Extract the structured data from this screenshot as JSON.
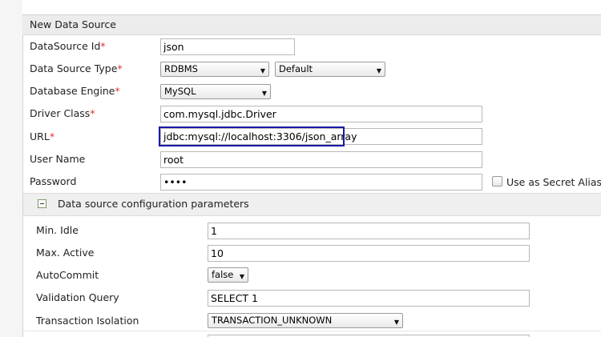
{
  "panel": {
    "title": "New Data Source"
  },
  "required_marker": "*",
  "fields": {
    "datasource_id": {
      "label": "DataSource Id",
      "value": "json"
    },
    "data_source_type": {
      "label": "Data Source Type",
      "value": "RDBMS",
      "second_value": "Default"
    },
    "database_engine": {
      "label": "Database Engine",
      "value": "MySQL"
    },
    "driver_class": {
      "label": "Driver Class",
      "value": "com.mysql.jdbc.Driver"
    },
    "url": {
      "label": "URL",
      "value": "jdbc:mysql://localhost:3306/json_array"
    },
    "user_name": {
      "label": "User Name",
      "value": "root"
    },
    "password": {
      "label": "Password",
      "value": "••••",
      "secret_alias_label": "Use as Secret Alias"
    }
  },
  "config_section": {
    "title": "Data source configuration parameters",
    "min_idle": {
      "label": "Min. Idle",
      "value": "1"
    },
    "max_active": {
      "label": "Max. Active",
      "value": "10"
    },
    "autocommit": {
      "label": "AutoCommit",
      "value": "false"
    },
    "validation_query": {
      "label": "Validation Query",
      "value": "SELECT 1"
    },
    "transaction_isolation": {
      "label": "Transaction Isolation",
      "value": "TRANSACTION_UNKNOWN"
    }
  },
  "icons": {
    "dropdown": "caret-down-icon",
    "collapse": "minus-box-icon"
  },
  "colors": {
    "required": "#e03030",
    "highlight_border": "#1a1aa8",
    "header_bg": "#ececec"
  }
}
